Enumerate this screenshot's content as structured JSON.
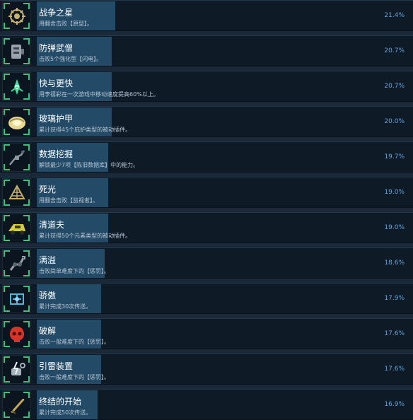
{
  "accent_bar_color": "#234b68",
  "icon_corner_color": "#3fbf7a",
  "percent_color": "#66a4d8",
  "achievements": [
    {
      "title": "战争之星",
      "desc": "用翻舍击败【原型】。",
      "percent": "21.4%",
      "icon": "golden-gear-icon",
      "icon_color": "#c9b36a"
    },
    {
      "title": "防弹武僧",
      "desc": "击败5个强化型【闪电】。",
      "percent": "20.7%",
      "icon": "armored-device-icon",
      "icon_color": "#9aa3ad"
    },
    {
      "title": "快与更快",
      "desc": "用李禧彩在一次游戏中移动速度提高60%以上。",
      "percent": "20.7%",
      "icon": "green-energy-icon",
      "icon_color": "#3fe0a0"
    },
    {
      "title": "玻璃护甲",
      "desc": "累计获得45个庇护类型的被动插件。",
      "percent": "20.0%",
      "icon": "glass-orb-icon",
      "icon_color": "#e8d890"
    },
    {
      "title": "数据挖掘",
      "desc": "解锁最少7项【陈旧数据库】中的能力。",
      "percent": "19.7%",
      "icon": "data-drone-icon",
      "icon_color": "#8c96a3"
    },
    {
      "title": "死光",
      "desc": "用翻舍击败【监视者】。",
      "percent": "19.0%",
      "icon": "golden-mesh-icon",
      "icon_color": "#c2b06a"
    },
    {
      "title": "清道夫",
      "desc": "累计获得50个元素类型的被动插件。",
      "percent": "19.0%",
      "icon": "yellow-vehicle-icon",
      "icon_color": "#d6cf3a"
    },
    {
      "title": "满溢",
      "desc": "击败简单难度下的【惩罚】。",
      "percent": "18.6%",
      "icon": "robot-arm-icon",
      "icon_color": "#9aa3ad"
    },
    {
      "title": "骄傲",
      "desc": "累计完成30次传送。",
      "percent": "17.9%",
      "icon": "teleporter-icon",
      "icon_color": "#4fb8d8"
    },
    {
      "title": "破解",
      "desc": "击败一般难度下的【惩罚】。",
      "percent": "17.6%",
      "icon": "red-skull-icon",
      "icon_color": "#d8342a"
    },
    {
      "title": "引雷装置",
      "desc": "击败一般难度下的【惩罚】。",
      "percent": "17.6%",
      "icon": "lightning-device-icon",
      "icon_color": "#a8b2bd"
    },
    {
      "title": "终结的开始",
      "desc": "累计完成50次传送。",
      "percent": "16.9%",
      "icon": "golden-blade-icon",
      "icon_color": "#c9a850"
    }
  ]
}
